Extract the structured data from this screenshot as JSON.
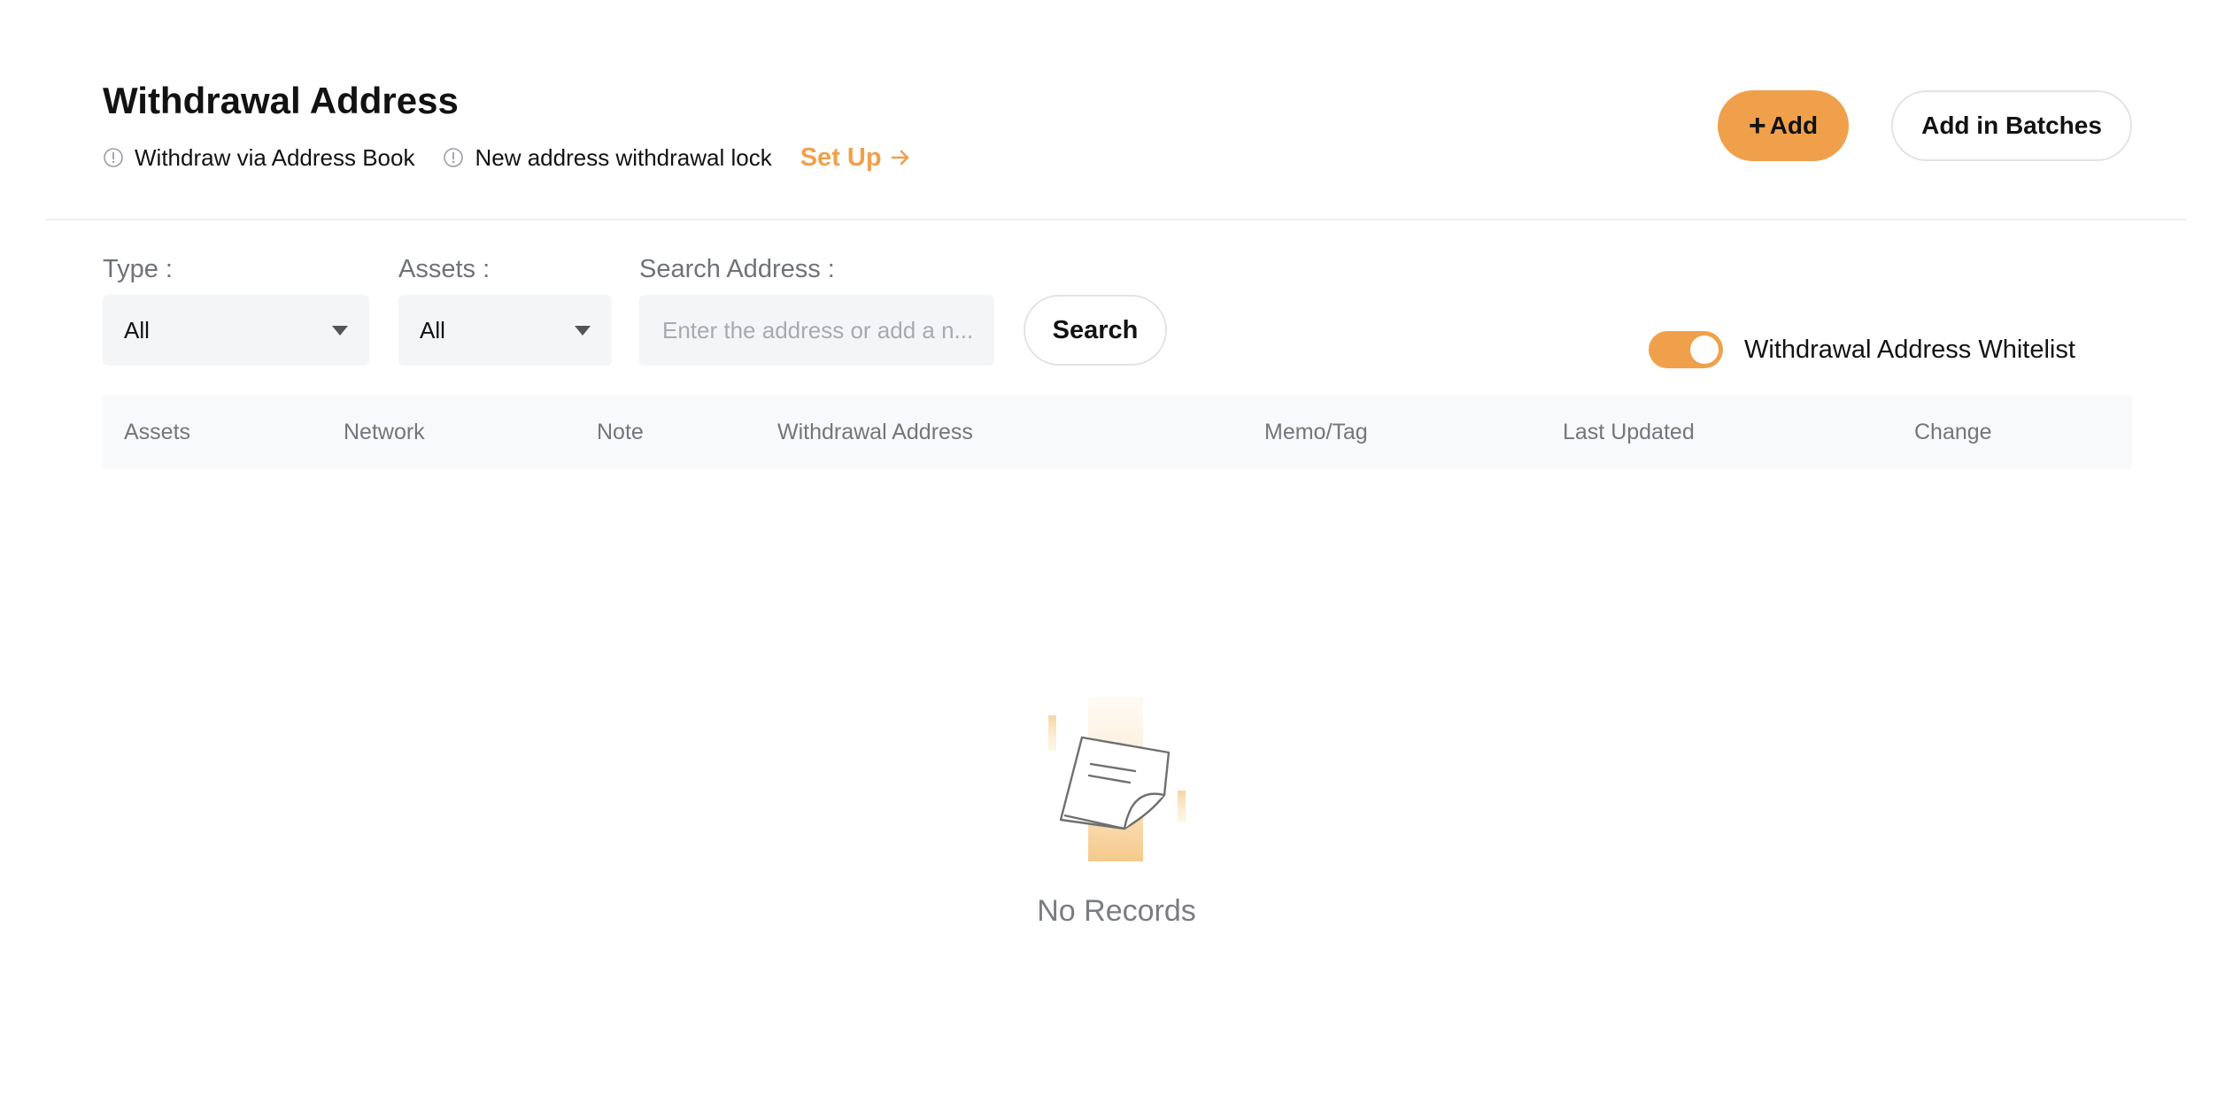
{
  "header": {
    "title": "Withdrawal Address",
    "info_items": [
      {
        "label": "Withdraw via Address Book",
        "icon": "info-circle-icon"
      },
      {
        "label": "New address withdrawal lock",
        "icon": "info-circle-icon"
      }
    ],
    "setup_label": "Set Up",
    "add_label": "Add",
    "add_batches_label": "Add in Batches"
  },
  "filters": {
    "type_label": "Type :",
    "type_value": "All",
    "assets_label": "Assets :",
    "assets_value": "All",
    "search_label": "Search Address :",
    "search_placeholder": "Enter the address or add a n...",
    "search_value": "",
    "search_button": "Search"
  },
  "whitelist": {
    "label": "Withdrawal Address Whitelist",
    "enabled": true
  },
  "table": {
    "columns": [
      "Assets",
      "Network",
      "Note",
      "Withdrawal Address",
      "Memo/Tag",
      "Last Updated",
      "Change"
    ],
    "rows": []
  },
  "empty_state": {
    "text": "No Records",
    "icon": "empty-document-icon"
  },
  "colors": {
    "accent": "#f0a04b",
    "text": "#121212",
    "muted": "#73767c",
    "input_bg": "#f4f5f7"
  }
}
